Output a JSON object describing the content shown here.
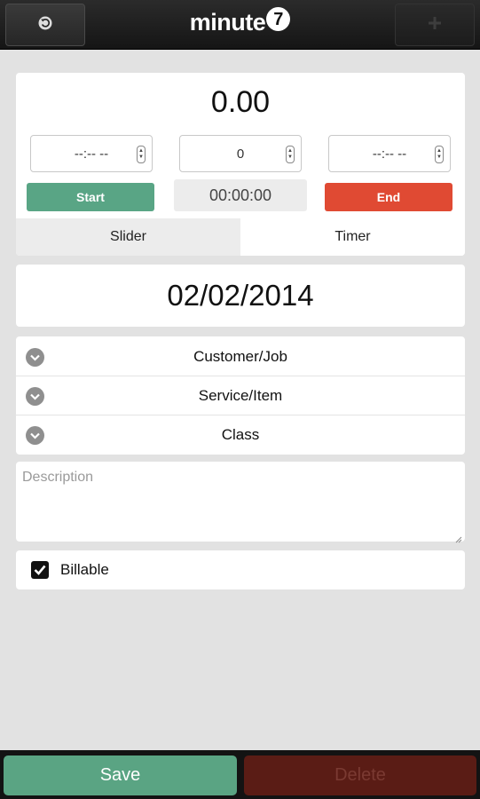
{
  "header": {
    "back_icon": "undo-icon",
    "add_icon": "plus-icon",
    "logo_text": "minute",
    "logo_mark": "7"
  },
  "timer": {
    "amount": "0.00",
    "start_time_placeholder": "--:-- --",
    "duration_value": "0",
    "end_time_placeholder": "--:-- --",
    "start_label": "Start",
    "end_label": "End",
    "elapsed": "00:00:00",
    "tabs": [
      {
        "label": "Slider",
        "selected": false
      },
      {
        "label": "Timer",
        "selected": true
      }
    ]
  },
  "date": "02/02/2014",
  "dropdowns": [
    {
      "label": "Customer/Job",
      "icon": "chevron-down-icon"
    },
    {
      "label": "Service/Item",
      "icon": "chevron-down-icon"
    },
    {
      "label": "Class",
      "icon": "chevron-down-icon"
    }
  ],
  "description": {
    "placeholder": "Description",
    "value": ""
  },
  "billable": {
    "label": "Billable",
    "checked": true
  },
  "footer": {
    "save_label": "Save",
    "delete_label": "Delete"
  },
  "colors": {
    "start_green": "#59a585",
    "end_red": "#e04a33",
    "save_green": "#5aa483",
    "delete_dark_red": "#5a1c15",
    "header_bg": "#1e1e1e",
    "page_bg": "#e2e2e2"
  }
}
